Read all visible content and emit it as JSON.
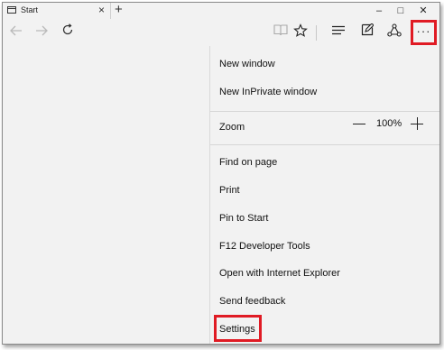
{
  "tab": {
    "title": "Start",
    "close_glyph": "×",
    "favicon": "page-icon"
  },
  "new_tab_glyph": "+",
  "window_controls": {
    "minimize": "–",
    "maximize": "□",
    "close": "✕"
  },
  "nav": {
    "back_icon": "back-arrow-icon",
    "forward_icon": "forward-arrow-icon",
    "refresh_icon": "refresh-icon",
    "reading_view_icon": "book-icon",
    "favorites_icon": "star-icon",
    "hub_icon": "hub-icon",
    "note_icon": "web-note-icon",
    "share_icon": "share-icon",
    "more_glyph": "···"
  },
  "menu": {
    "new_window": "New window",
    "new_inprivate": "New InPrivate window",
    "zoom_label": "Zoom",
    "zoom_value": "100%",
    "find": "Find on page",
    "print": "Print",
    "pin": "Pin to Start",
    "devtools": "F12 Developer Tools",
    "open_ie": "Open with Internet Explorer",
    "feedback": "Send feedback",
    "settings": "Settings"
  },
  "highlight_color": "#e01b24"
}
